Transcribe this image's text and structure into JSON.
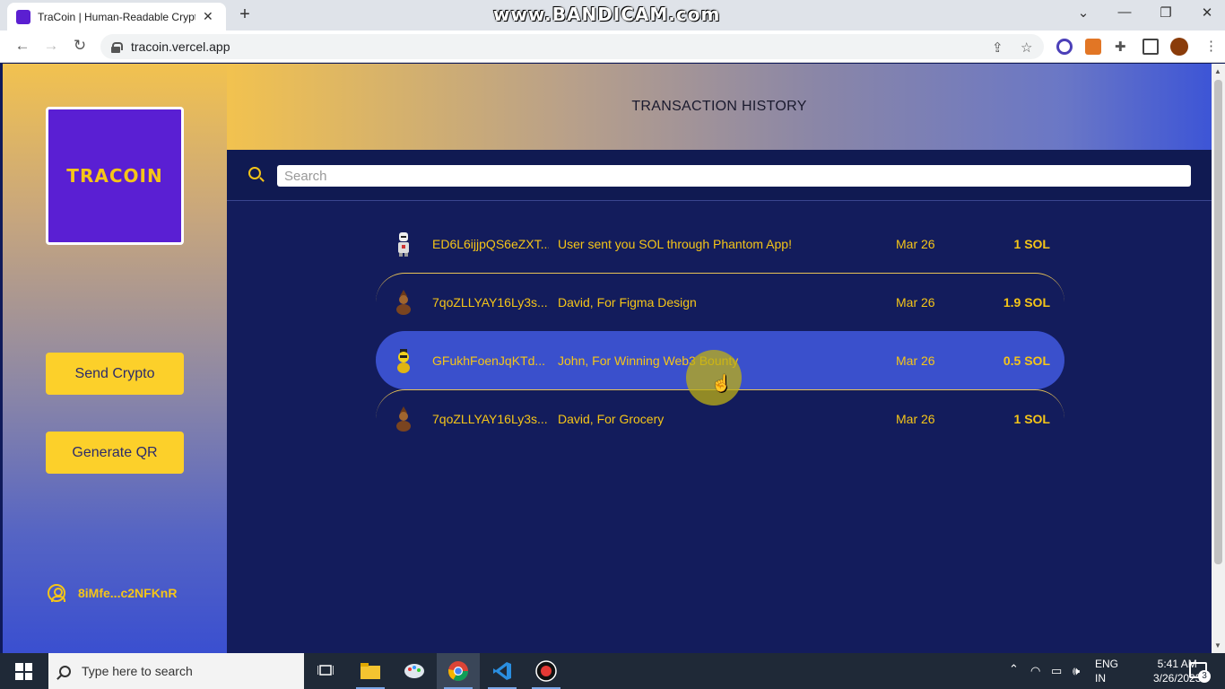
{
  "browser": {
    "tab_title": "TraCoin | Human-Readable Crypto",
    "url": "tracoin.vercel.app",
    "watermark": "www.BANDICAM.com"
  },
  "sidebar": {
    "logo_text": "TRACOIN",
    "buttons": [
      {
        "label": "Send Crypto"
      },
      {
        "label": "Generate QR"
      }
    ],
    "wallet_address": "8iMfe...c2NFKnR"
  },
  "main": {
    "title": "TRANSACTION HISTORY",
    "search_placeholder": "Search",
    "transactions": [
      {
        "hash": "ED6L6ijjpQS6eZXT...",
        "description": "User sent you SOL through Phantom App!",
        "date": "Mar 26",
        "amount": "1 SOL",
        "avatar": "white-robot-avatar"
      },
      {
        "hash": "7qoZLLYAY16Ly3s...",
        "description": "David, For Figma Design",
        "date": "Mar 26",
        "amount": "1.9 SOL",
        "avatar": "brown-character-avatar"
      },
      {
        "hash": "GFukhFoenJqKTd...",
        "description": "John, For Winning Web3 Bounty",
        "date": "Mar 26",
        "amount": "0.5 SOL",
        "avatar": "yellow-character-avatar"
      },
      {
        "hash": "7qoZLLYAY16Ly3s...",
        "description": "David, For Grocery",
        "date": "Mar 26",
        "amount": "1 SOL",
        "avatar": "brown-character-avatar"
      }
    ]
  },
  "taskbar": {
    "search_placeholder": "Type here to search",
    "language": "ENG",
    "region": "IN",
    "time": "5:41 AM",
    "date": "3/26/2023",
    "notification_count": "3"
  },
  "colors": {
    "accent": "#f5c518",
    "main_bg": "#131c5c",
    "active_row": "#3a50cc",
    "logo_bg": "#5a1fd3"
  }
}
